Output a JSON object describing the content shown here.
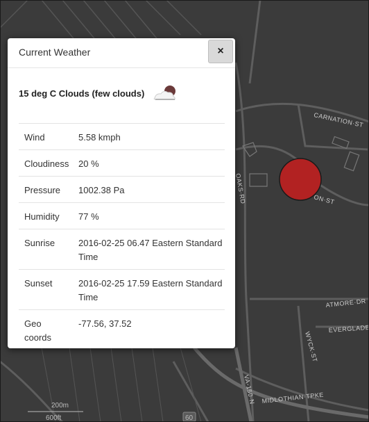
{
  "map": {
    "streets": [
      "CARNATION·ST",
      "OAKS·RD",
      "ON·ST",
      "ATMORE·DR",
      "WYCK·ST",
      "EVERGLADES",
      "MIDLOTHIAN·TPKE",
      "VA-150·N"
    ],
    "route_shield": "60",
    "scale": [
      "200m",
      "600ft"
    ],
    "marker_color": "#b22222"
  },
  "popup": {
    "title": "Current Weather",
    "close_label": "×",
    "summary": "15 deg C Clouds (few clouds)",
    "weather_icon": "few-clouds-icon",
    "rows": [
      {
        "label": "Wind",
        "value": "5.58 kmph"
      },
      {
        "label": "Cloudiness",
        "value": "20 %"
      },
      {
        "label": "Pressure",
        "value": "1002.38 Pa"
      },
      {
        "label": "Humidity",
        "value": "77 %"
      },
      {
        "label": "Sunrise",
        "value": "2016-02-25 06.47 Eastern Standard Time"
      },
      {
        "label": "Sunset",
        "value": "2016-02-25 17.59 Eastern Standard Time"
      },
      {
        "label": "Geo coords",
        "value": "-77.56, 37.52"
      }
    ]
  }
}
